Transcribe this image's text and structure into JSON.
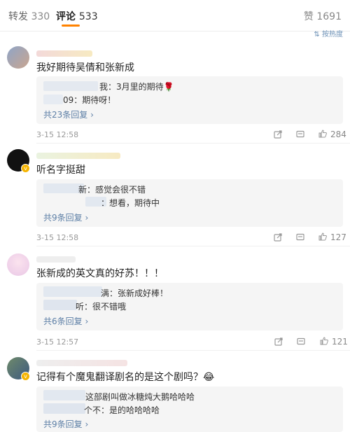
{
  "tabs": {
    "repost_label": "转发",
    "repost_count": "330",
    "comment_label": "评论",
    "comment_count": "533",
    "like_label": "赞",
    "like_count": "1691"
  },
  "sort_label": "按热度",
  "comments": [
    {
      "text": "我好期待吴倩和张新成",
      "replies": [
        "我：3月里的期待🌹",
        "09：期待呀！"
      ],
      "more": "共23条回复 ›",
      "time": "3-15 12:58",
      "likes": "284"
    },
    {
      "text": "听名字挺甜",
      "replies": [
        "新：感觉会很不错",
        "：想看，期待中"
      ],
      "more": "共9条回复 ›",
      "time": "3-15 12:58",
      "likes": "127"
    },
    {
      "text": "张新成的英文真的好苏！！！",
      "replies": [
        "满：张新成好棒！",
        "听：很不错哦"
      ],
      "more": "共6条回复 ›",
      "time": "3-15 12:57",
      "likes": "121"
    },
    {
      "text": "记得有个魔鬼翻译剧名的是这个剧吗？😂",
      "replies": [
        "这部剧叫做冰糖炖大鹅哈哈哈",
        "个不：是的哈哈哈哈"
      ],
      "more": "共9条回复 ›",
      "time": "",
      "likes": ""
    }
  ],
  "colors": {
    "accent": "#ff8200",
    "link": "#5d7fa6"
  }
}
